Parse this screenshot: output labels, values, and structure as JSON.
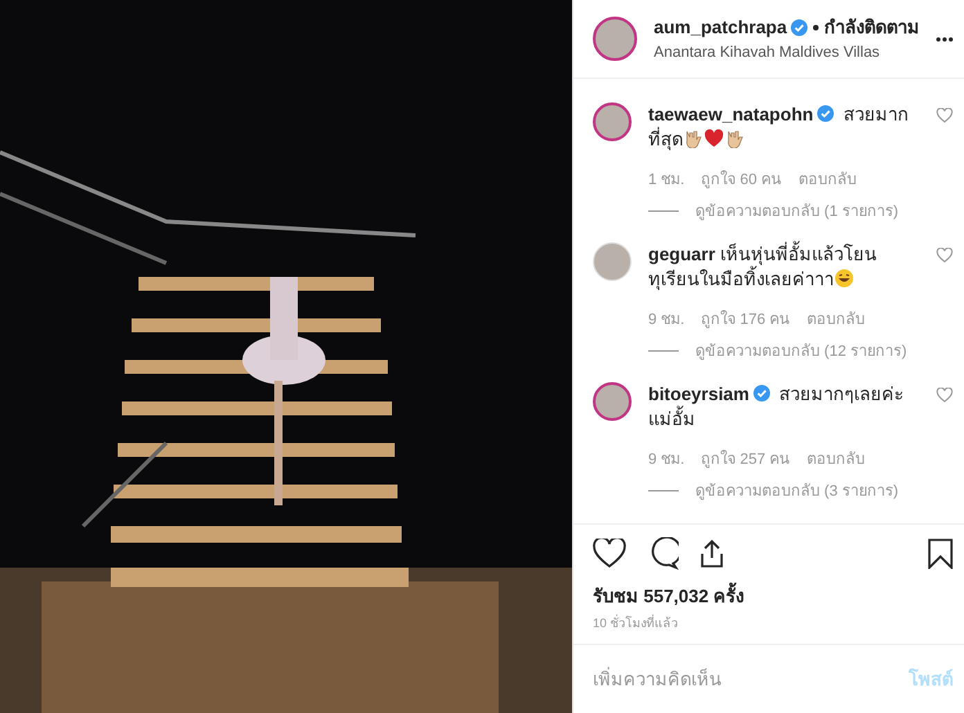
{
  "post": {
    "username": "aum_patchrapa",
    "verified": true,
    "follow_status": "กำลังติดตาม",
    "location": "Anantara Kihavah Maldives Villas"
  },
  "comments": [
    {
      "username": "taewaew_natapohn",
      "verified": true,
      "text": "สวยมากที่สุด",
      "reactions": [
        {
          "kind": "hand"
        },
        {
          "kind": "heart"
        },
        {
          "kind": "hand"
        }
      ],
      "time": "1 ชม.",
      "likes": "ถูกใจ 60 คน",
      "reply": "ตอบกลับ",
      "view_replies": "ดูข้อความตอบกลับ (1 รายการ)",
      "liked": false
    },
    {
      "username": "geguarr",
      "verified": false,
      "text": "เห็นหุ่นพี่อั้มแล้วโยนทุเรียนในมือทิ้งเลยค่าาา",
      "reactions": [
        {
          "kind": "laugh"
        }
      ],
      "time": "9 ชม.",
      "likes": "ถูกใจ 176 คน",
      "reply": "ตอบกลับ",
      "view_replies": "ดูข้อความตอบกลับ (12 รายการ)",
      "liked": false
    },
    {
      "username": "bitoeyrsiam",
      "verified": true,
      "text": "สวยมากๆเลยค่ะแม่อั้ม",
      "time": "9 ชม.",
      "likes": "ถูกใจ 257 คน",
      "reply": "ตอบกลับ",
      "view_replies": "ดูข้อความตอบกลับ (3 รายการ)",
      "liked": false
    }
  ],
  "views": "รับชม 557,032 ครั้ง",
  "posted": "10 ชั่วโมงที่แล้ว",
  "add_comment": {
    "placeholder": "เพิ่มความคิดเห็น",
    "post_button": "โพสต์",
    "post_enabled": false
  }
}
